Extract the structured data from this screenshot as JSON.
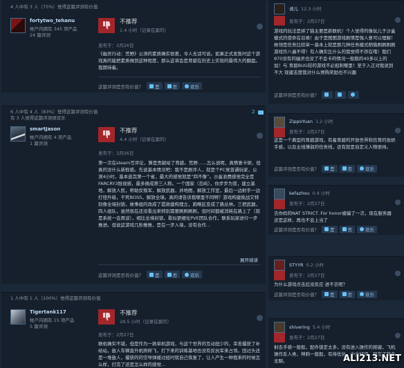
{
  "reviews": [
    {
      "helpful": "4 人中有 3 人（75%）觉得这篇评测有价值",
      "helpful2": "",
      "author": "fortytwo_tehanu",
      "account": "帐户内拥有 345 项产品",
      "reviews_count": "24 篇评测",
      "verdict": "不推荐",
      "hours": "1.4 小时（记录在案的）",
      "posted": "发布于：2月26日",
      "text": "《幽灵行动：荒野》公测的素质确实很差，令人无话可说。如果正式发售时这个游戏真的能把素质做到这种程度，那么这将会是育碧在历史上实现的最伟大的翻盘。我期待着。",
      "vote_q": "这篇评测是否有价值？",
      "yes": "是",
      "no": "否",
      "funny": "欢乐",
      "comments": "",
      "expand": ""
    },
    {
      "helpful": "6 人中有 4 人（83%）觉得这篇评测有价值",
      "helpful2": "有 3 人觉得这篇评测很欢乐",
      "author": "smartJason",
      "account": "帐户内拥有 4 项产品",
      "reviews_count": "1 篇评测",
      "verdict": "不推荐",
      "hours": "4.4 小时（记录在案的）",
      "posted": "发布于：2月26日",
      "text": "第一次在steam写评论，算是贡献给了育碧。荒野……怎么说呢，真情意卡顿，但真的没什么新鲜感。先说基本情况吧：我不是剧评人，就是个PC党普通玩家，公测4小时，基本逛完第一个省，最大的感觉就是“四不像”。沙盒浪费感觉完全是FARCRY3既视感，最多换成第三人称。一个国家（岛屿），你步步为营，建立基地，解放人民，帮助反叛军，解放武器，并地图，解放工作室，最后一边射手一边打怪升级，干死BOSS，解放全境。真的请告诉我哪里不同啊？游戏构建挑战又特别像全境封锁，故事组的改成了提款建构理立，跑略区变成了路丛林。三把武器，四人组队，虽然现在还没看出来特别需要刷刷刷刷，但时间都被消耗在路上了（就是系统一会再谈），相比全境封锁，看似更细化PVE团队合作，联系玩家进行一步推进。但说这游戏几秒推推，是在一步入境，没有合作...",
      "vote_q": "这篇评测是否有价值？",
      "yes": "是",
      "no": "否",
      "funny": "欢乐",
      "comments": "2",
      "expand": "展开阅读"
    },
    {
      "helpful": "1 人中有 1 人（100%）觉得这篇评测有价值",
      "helpful2": "",
      "author": "Tigertank117",
      "account": "帐户内拥有 15 项产品",
      "reviews_count": "5 篇评测",
      "verdict": "不推荐",
      "hours": "28.5 小时（记录在案的）",
      "posted": "发布于：2月27日",
      "text": "联机确实不错，但是作为一款单机游戏，与这个世界的互动扭少的，幸苦撮获了补给站，敌人车辆直升机照样飞，打下来的训练基地也没有反抗军来占领。回过头还是一堆敌人，撮获的的空导弹缓过经时就自己恢复了，让人产生一种我来的时候怎么样，打完了还是怎么样的感觉...",
      "vote_q": "",
      "yes": "",
      "no": "",
      "funny": "",
      "comments": "",
      "expand": ""
    }
  ],
  "right_reviews": [
    {
      "name": "诱儿",
      "hours": "12.3 小时",
      "posted": "发布于：2月27日",
      "text": "游戏的玩法是拼了猫主要是新联机！个人觉得的像玩儿于沙盒模式的使命在召唤！由于是图图游戏剧情是强人意可以理解！故领是任务比较单一基本上就是那几种任务模式稍微刷刷刷刷游戏作八遍不得！有人确实比什么的我觉得不存在哦！我们 970没有的幽灵也没了不会卡的情况一般稳的40多以上的加！与 育碧BUG较的游戏不必担刺哪里！至于入正对我说到不大 现建志度我对什么预购奖励也不兴趣",
      "vote_q": "这篇评测是否有价值？",
      "yes": "",
      "no": "",
      "funny": ""
    },
    {
      "name": "ZippoYuan",
      "hours": "1.2 小时",
      "posted": "发布于：2月27日",
      "text": "这是一个典型的育碧游戏，有着育碧的开放世界和信育的张娇手感，以及主线薄弱的任务线，还有就是自定义人物很帅。",
      "vote_q": "这篇评测是否有价值？",
      "yes": "是",
      "no": "否",
      "funny": "欢乐"
    },
    {
      "name": "kefazhou",
      "hours": "0.4 小时",
      "posted": "发布于：2月27日",
      "text": "去你妈的NAT STRICT. For honor被骗了一次，现在服务器还是这样，再也不会上当了",
      "vote_q": "这篇评测是否有价值？",
      "yes": "是",
      "no": "否",
      "funny": "欢乐"
    },
    {
      "name": "STYYR",
      "hours": "0.2 小时",
      "posted": "发布于：2月27日",
      "text": "为什么游戏点击后没反应 进不去呢？",
      "vote_q": "这篇评测是否有价值？",
      "yes": "是",
      "no": "否",
      "funny": "欢乐"
    },
    {
      "name": "shivering",
      "hours": "5.4 小时",
      "posted": "发布于：2月27日",
      "text": "射击手感一般般，配件锁定太多，没有进入操作的按键，飞机操作反人类，神鸦一般般，有待优化，中文好评，现交了就会无聊。"
    }
  ],
  "watermark": "ALI213.NET",
  "colors": {
    "background": "#1b2838",
    "thumbs_down": "#a3262a",
    "link": "#c1dbf4"
  },
  "icons": [
    "thumbs-down-icon",
    "thumbs-up-icon",
    "funny-face-icon",
    "steam-icon",
    "comment-icon"
  ]
}
